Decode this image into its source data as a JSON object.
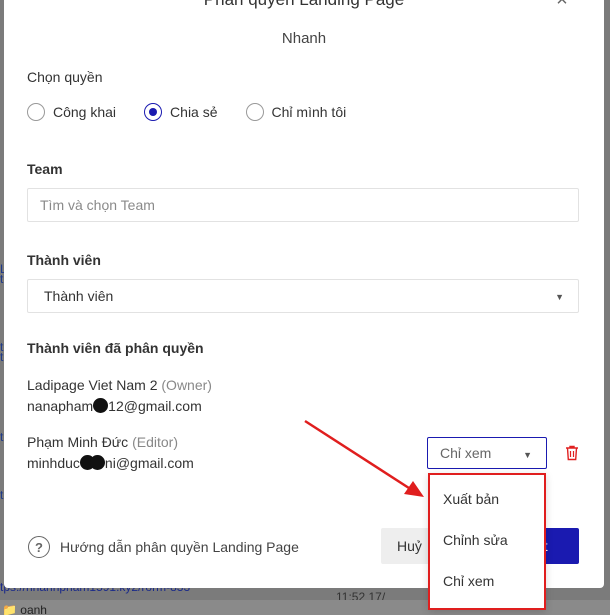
{
  "modal": {
    "title": "Phân quyền Landing Page",
    "subtitle": "Nhanh",
    "close_icon": "×"
  },
  "permission": {
    "label": "Chọn quyền",
    "options": [
      "Công khai",
      "Chia sẻ",
      "Chỉ mình tôi"
    ],
    "selected": "Chia sẻ"
  },
  "team": {
    "label": "Team",
    "placeholder": "Tìm và chọn Team"
  },
  "member": {
    "label": "Thành viên",
    "value": "Thành viên"
  },
  "assigned": {
    "label": "Thành viên đã phân quyền",
    "members": [
      {
        "name": "Ladipage Viet Nam 2",
        "role": "(Owner)",
        "email_prefix": "nanapham",
        "email_suffix": "12@gmail.com"
      },
      {
        "name": "Phạm Minh Đức",
        "role": "(Editor)",
        "email_prefix": "minhduc",
        "email_suffix": "ni@gmail.com",
        "permission": "Chỉ xem"
      }
    ]
  },
  "dropdown": {
    "options": [
      "Xuất bản",
      "Chỉnh sửa",
      "Chỉ xem"
    ]
  },
  "footer": {
    "help_icon": "?",
    "help_text": "Hướng dẫn phân quyền Landing Page",
    "cancel_label": "Huỷ",
    "primary_label": "ật"
  },
  "background": {
    "left_chars": [
      "L",
      "t",
      "t",
      "t",
      "t",
      "t"
    ],
    "link_text": "tps://nhanhpham1591.ky2/rorm-833",
    "time_text": "11:52 17/",
    "folder_text": "oanh"
  },
  "colors": {
    "accent": "#1a1ab0",
    "highlight": "#e01e1e",
    "trash": "#e02020"
  }
}
